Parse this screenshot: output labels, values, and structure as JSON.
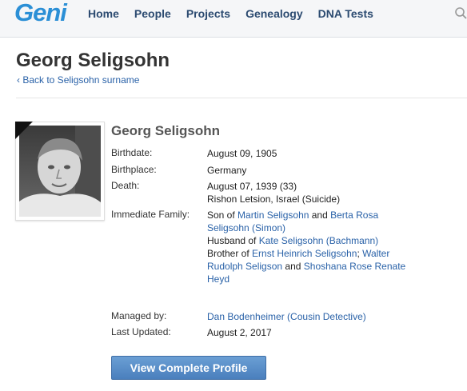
{
  "site": {
    "logo": "Geni"
  },
  "nav": [
    "Home",
    "People",
    "Projects",
    "Genealogy",
    "DNA Tests"
  ],
  "header": {
    "title": "Georg Seligsohn",
    "back_link": "‹ Back to Seligsohn surname"
  },
  "profile": {
    "name": "Georg Seligsohn",
    "birthdate_label": "Birthdate:",
    "birthdate": "August 09, 1905",
    "birthplace_label": "Birthplace:",
    "birthplace": "Germany",
    "death_label": "Death:",
    "death_date": "August 07, 1939 (33)",
    "death_place": "Rishon Letsion, Israel (Suicide)",
    "family_label": "Immediate Family:",
    "family": {
      "son_of": "Son of ",
      "father": "Martin Seligsohn",
      "and1": " and ",
      "mother_a": "Berta Rosa",
      "mother_b": "Seligsohn (Simon)",
      "husband_of": "Husband of ",
      "wife": "Kate Seligsohn (Bachmann)",
      "brother_of": "Brother of ",
      "brother1": "Ernst Heinrich Seligsohn",
      "sep": "; ",
      "brother2_a": "Walter",
      "brother2_b": "Rudolph Seligson",
      "and2": " and ",
      "sister_a": "Shoshana Rose Renate",
      "sister_b": "Heyd"
    },
    "managed_label": "Managed by:",
    "manager": "Dan Bodenheimer (Cousin Detective)",
    "updated_label": "Last Updated:",
    "updated": "August 2, 2017",
    "button": "View Complete Profile"
  },
  "icons": {
    "search": "search-icon",
    "mourning": "mourning-ribbon-icon"
  },
  "colors": {
    "link": "#2a62a8",
    "logo": "#2b8fd6",
    "button": "#5a8fc8",
    "nav": "#2b4a70"
  }
}
